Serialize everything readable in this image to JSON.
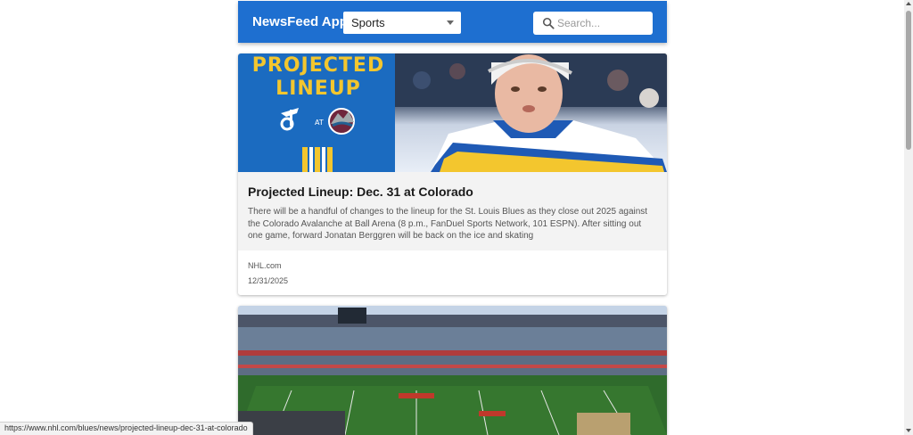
{
  "header": {
    "app_title": "NewsFeed App",
    "category_selected": "Sports",
    "search_placeholder": "Search..."
  },
  "articles": [
    {
      "image_text_line1": "PROJECTED",
      "image_text_line2": "LINEUP",
      "image_text_at": "AT",
      "title": "Projected Lineup: Dec. 31 at Colorado",
      "description": "There will be a handful of changes to the lineup for the St. Louis Blues as they close out 2025 against the Colorado Avalanche at Ball Arena (8 p.m., FanDuel Sports Network, 101 ESPN). After sitting out one game, forward Jonatan Berggren will be back on the ice and skating",
      "source": "NHL.com",
      "date": "12/31/2025"
    }
  ],
  "status_bar": {
    "url": "https://www.nhl.com/blues/news/projected-lineup-dec-31-at-colorado"
  },
  "colors": {
    "header_bg": "#1e6fd0",
    "blues_blue": "#1b6bc0",
    "blues_gold": "#f3c62e"
  }
}
